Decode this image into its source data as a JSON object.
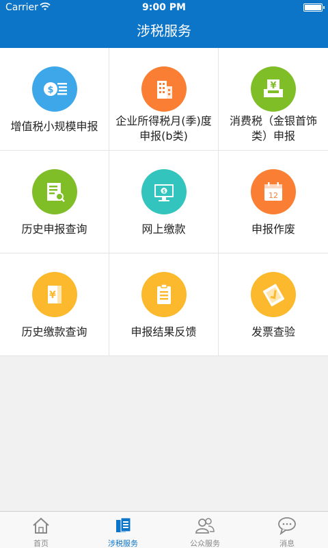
{
  "status_bar": {
    "carrier": "Carrier",
    "time": "9:00 PM"
  },
  "header": {
    "title": "涉税服务"
  },
  "services": [
    {
      "label": "增值税小规模申报",
      "color": "#3da7ea",
      "icon": "coin-list-icon"
    },
    {
      "label": "企业所得税月(季)度申报(b类)",
      "color": "#fa7f35",
      "icon": "building-icon"
    },
    {
      "label": "消费税（金银首饰类）申报",
      "color": "#80be28",
      "icon": "yen-tray-icon"
    },
    {
      "label": "历史申报查询",
      "color": "#80be28",
      "icon": "document-search-icon"
    },
    {
      "label": "网上缴款",
      "color": "#33c5bd",
      "icon": "monitor-payment-icon"
    },
    {
      "label": "申报作废",
      "color": "#fa7f35",
      "icon": "calendar-icon"
    },
    {
      "label": "历史缴款查询",
      "color": "#fcb92d",
      "icon": "yen-document-icon"
    },
    {
      "label": "申报结果反馈",
      "color": "#fcb92d",
      "icon": "clipboard-icon"
    },
    {
      "label": "发票查验",
      "color": "#fcb92d",
      "icon": "invoice-check-icon"
    }
  ],
  "tabs": [
    {
      "label": "首页",
      "icon": "home-icon",
      "active": false
    },
    {
      "label": "涉税服务",
      "icon": "tax-service-icon",
      "active": true
    },
    {
      "label": "公众服务",
      "icon": "people-icon",
      "active": false
    },
    {
      "label": "消息",
      "icon": "chat-icon",
      "active": false
    }
  ],
  "colors": {
    "primary": "#0d75c8",
    "tab_inactive": "#888888"
  }
}
